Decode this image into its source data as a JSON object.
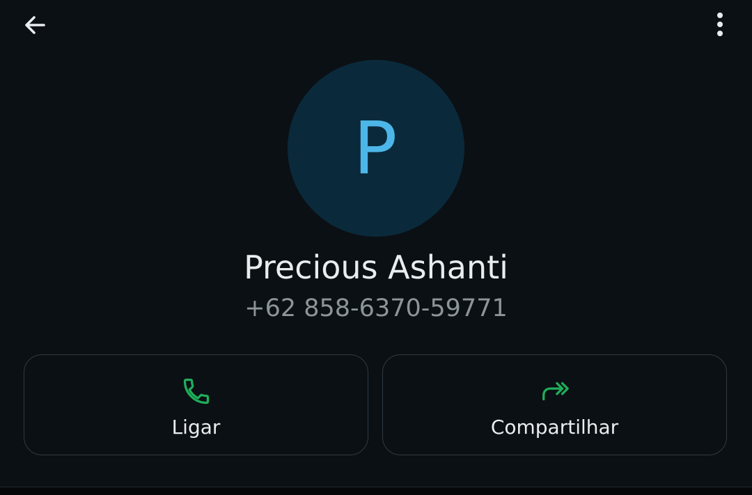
{
  "colors": {
    "background": "#0b1014",
    "avatar_background": "#0a2a3c",
    "avatar_letter": "#4db6e8",
    "accent_green": "#1fae5b",
    "text_primary": "#e9edef",
    "text_secondary": "#8d9599",
    "card_border": "#2f3b42"
  },
  "toolbar": {
    "back_icon": "arrow-left-icon",
    "menu_icon": "more-vertical-icon"
  },
  "contact": {
    "avatar_letter": "P",
    "name": "Precious Ashanti",
    "phone": "+62 858-6370-59771"
  },
  "actions": [
    {
      "icon": "phone-icon",
      "label": "Ligar"
    },
    {
      "icon": "share-forward-icon",
      "label": "Compartilhar"
    }
  ]
}
